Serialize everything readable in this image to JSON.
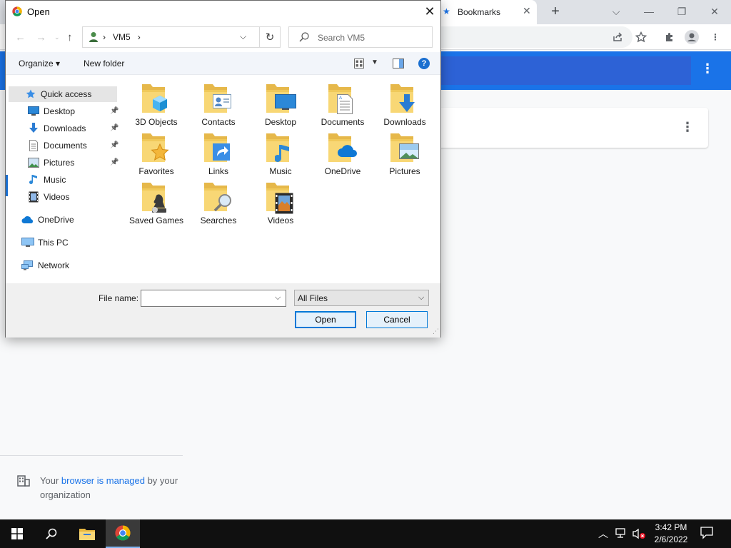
{
  "chrome": {
    "tab_title": "Bookmarks",
    "managed_prefix": "Your ",
    "managed_link": "browser is managed",
    "managed_suffix": " by your organization"
  },
  "dialog": {
    "title": "Open",
    "address": {
      "crumb_separator": "›",
      "crumb": "VM5"
    },
    "search_placeholder": "Search VM5",
    "toolbar": {
      "organize": "Organize",
      "new_folder": "New folder",
      "help": "?"
    },
    "nav": [
      {
        "label": "Quick access",
        "icon": "star-icon",
        "pinned": false,
        "selected": true
      },
      {
        "label": "Desktop",
        "icon": "desktop-icon",
        "pinned": true
      },
      {
        "label": "Downloads",
        "icon": "download-icon",
        "pinned": true
      },
      {
        "label": "Documents",
        "icon": "document-icon",
        "pinned": true
      },
      {
        "label": "Pictures",
        "icon": "picture-icon",
        "pinned": true
      },
      {
        "label": "Music",
        "icon": "music-note-icon",
        "pinned": false
      },
      {
        "label": "Videos",
        "icon": "film-icon",
        "pinned": false
      },
      {
        "label": "OneDrive",
        "icon": "cloud-icon",
        "pinned": false
      },
      {
        "label": "This PC",
        "icon": "computer-icon",
        "pinned": false
      },
      {
        "label": "Network",
        "icon": "network-icon",
        "pinned": false
      }
    ],
    "folders": [
      {
        "label": "3D Objects",
        "overlay": "cube-icon"
      },
      {
        "label": "Contacts",
        "overlay": "contact-card-icon"
      },
      {
        "label": "Desktop",
        "overlay": "desktop-icon"
      },
      {
        "label": "Documents",
        "overlay": "document-icon"
      },
      {
        "label": "Downloads",
        "overlay": "download-icon"
      },
      {
        "label": "Favorites",
        "overlay": "star-icon"
      },
      {
        "label": "Links",
        "overlay": "link-arrow-icon"
      },
      {
        "label": "Music",
        "overlay": "music-note-icon"
      },
      {
        "label": "OneDrive",
        "overlay": "cloud-icon"
      },
      {
        "label": "Pictures",
        "overlay": "picture-icon"
      },
      {
        "label": "Saved Games",
        "overlay": "chess-piece-icon"
      },
      {
        "label": "Searches",
        "overlay": "magnifier-icon"
      },
      {
        "label": "Videos",
        "overlay": "film-icon"
      }
    ],
    "file_name_label": "File name:",
    "file_name_value": "",
    "file_type": "All Files",
    "open_button": "Open",
    "cancel_button": "Cancel"
  },
  "taskbar": {
    "time": "3:42 PM",
    "date": "2/6/2022"
  },
  "colors": {
    "accent": "#0078d7",
    "chrome_blue": "#1a73e8",
    "folder_yellow": "#f8d775"
  }
}
